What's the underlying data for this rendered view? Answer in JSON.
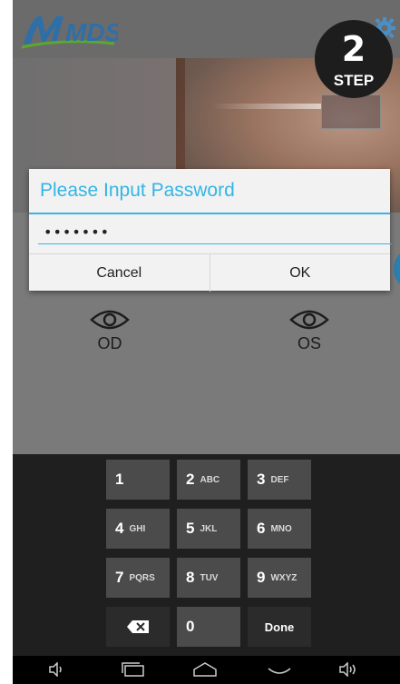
{
  "app": {
    "logo_text": "MDS",
    "settings_icon": "gear-icon"
  },
  "step_badge": {
    "number": "2",
    "label": "STEP"
  },
  "eye_selectors": {
    "od_label": "OD",
    "os_label": "OS",
    "icon": "eye-icon"
  },
  "dialog": {
    "title": "Please Input Password",
    "password_value": "•••••••",
    "cancel_label": "Cancel",
    "ok_label": "OK",
    "accent_color": "#33b5e5"
  },
  "keypad": {
    "rows": [
      [
        {
          "digit": "1",
          "letters": ""
        },
        {
          "digit": "2",
          "letters": "ABC"
        },
        {
          "digit": "3",
          "letters": "DEF"
        }
      ],
      [
        {
          "digit": "4",
          "letters": "GHI"
        },
        {
          "digit": "5",
          "letters": "JKL"
        },
        {
          "digit": "6",
          "letters": "MNO"
        }
      ],
      [
        {
          "digit": "7",
          "letters": "PQRS"
        },
        {
          "digit": "8",
          "letters": "TUV"
        },
        {
          "digit": "9",
          "letters": "WXYZ"
        }
      ]
    ],
    "delete_icon": "backspace-icon",
    "zero": "0",
    "done_label": "Done"
  },
  "navbar": {
    "icons": [
      "volume-down-icon",
      "recent-apps-icon",
      "home-icon",
      "back-icon",
      "volume-up-icon"
    ]
  }
}
